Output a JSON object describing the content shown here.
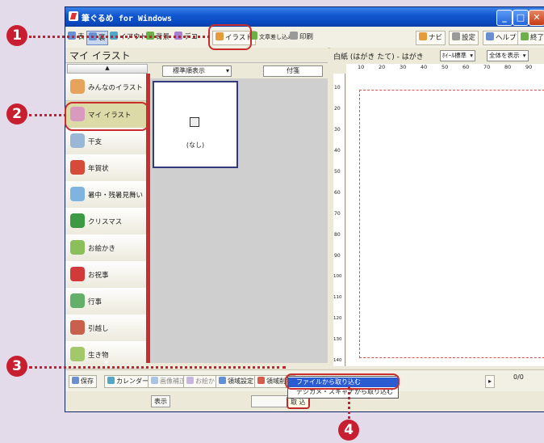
{
  "window": {
    "title": "筆ぐるめ for Windows",
    "buttons": [
      "_",
      "□",
      "✕"
    ]
  },
  "toolbar": {
    "items": [
      "表",
      "裏",
      "イアウト",
      "背景",
      "デコ",
      "イラスト",
      "文章差し込み",
      "印刷"
    ],
    "right": [
      "ナビ",
      "設定",
      "ヘルプ",
      "終了"
    ]
  },
  "left_pane": {
    "title": "マイ イラスト",
    "scroll_up": "▲",
    "scroll_down": "▼",
    "sort_select": "標準順表示",
    "tag_select": "付箋",
    "categories": [
      {
        "label": "みんなのイラスト",
        "icon": "people-icon"
      },
      {
        "label": "マイ イラスト",
        "icon": "my-illust-icon"
      },
      {
        "label": "干支",
        "icon": "zodiac-icon"
      },
      {
        "label": "年賀状",
        "icon": "new-year-card-icon"
      },
      {
        "label": "暑中・残暑見舞い",
        "icon": "summer-greeting-icon"
      },
      {
        "label": "クリスマス",
        "icon": "christmas-tree-icon"
      },
      {
        "label": "お絵かき",
        "icon": "drawing-icon"
      },
      {
        "label": "お祝事",
        "icon": "celebration-icon"
      },
      {
        "label": "行事",
        "icon": "event-icon"
      },
      {
        "label": "引越し",
        "icon": "moving-icon"
      },
      {
        "label": "生き物",
        "icon": "creature-icon"
      }
    ],
    "thumbnail_label": "(なし)",
    "bottom": {
      "display": "表示",
      "import": "取 込"
    }
  },
  "right_pane": {
    "paper_info": "白紙 (はがき たて) - はがき",
    "font_select": "ﾎｲｰﾙ標準",
    "zoom_select": "全体を表示",
    "ruler_top": [
      "10",
      "20",
      "30",
      "40",
      "50",
      "60",
      "70",
      "80",
      "90"
    ],
    "ruler_left": [
      "10",
      "20",
      "30",
      "40",
      "50",
      "60",
      "70",
      "80",
      "90",
      "100",
      "110",
      "120",
      "130",
      "140"
    ]
  },
  "statusbar": {
    "items": [
      "保存",
      "カレンダー",
      "画像補正",
      "お絵かき",
      "領域設定",
      "領域削除"
    ],
    "page_counter": "0/0"
  },
  "import_menu": {
    "items": [
      "ファイルから取り込む",
      "デジカメ・スキャナから取り込む"
    ]
  },
  "callouts": [
    "1",
    "2",
    "3",
    "4"
  ],
  "colors": {
    "accent": "#c71f2f",
    "titlebar": "#0a49c0",
    "menu_highlight": "#2a5bd0"
  }
}
